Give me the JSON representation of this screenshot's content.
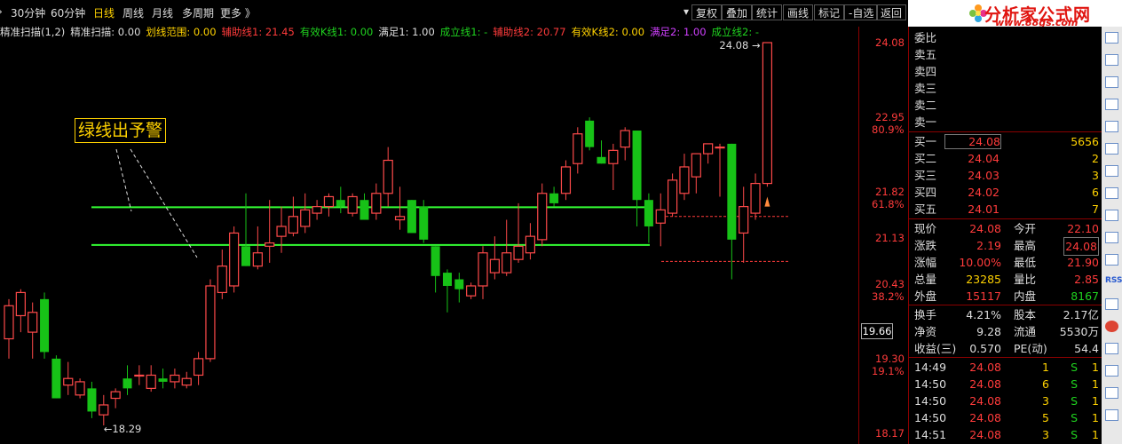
{
  "toolbar": {
    "periods": [
      "30分钟",
      "60分钟",
      "日线",
      "周线",
      "月线",
      "多周期",
      "更多 》"
    ],
    "active_period": "日线",
    "buttons": [
      "复权",
      "叠加",
      "统计",
      "画线",
      "标记",
      "-自选",
      "返回"
    ]
  },
  "indicator_bar": [
    {
      "label": "精准扫描(1,2)",
      "color": "#dddddd"
    },
    {
      "label": "精准扫描: 0.00",
      "color": "#dddddd"
    },
    {
      "label": "划线范围: 0.00",
      "color": "#ffd200"
    },
    {
      "label": "辅助线1: 21.45",
      "color": "#ff3b3b"
    },
    {
      "label": "有效K线1: 0.00",
      "color": "#1fd21f"
    },
    {
      "label": "满足1: 1.00",
      "color": "#dddddd"
    },
    {
      "label": "成立线1: -",
      "color": "#1fd21f"
    },
    {
      "label": "辅助线2: 20.77",
      "color": "#ff3b3b"
    },
    {
      "label": "有效K线2: 0.00",
      "color": "#ffd200"
    },
    {
      "label": "满足2: 1.00",
      "color": "#d040ff"
    },
    {
      "label": "成立线2: -",
      "color": "#1fd21f"
    }
  ],
  "annotation": "绿线出予警",
  "price_axis": [
    {
      "price": "24.08",
      "pct": ""
    },
    {
      "price": "22.95",
      "pct": "80.9%"
    },
    {
      "price": "21.82",
      "pct": "61.8%"
    },
    {
      "price": "21.13",
      "pct": ""
    },
    {
      "price": "20.43",
      "pct": "38.2%"
    },
    {
      "price": "19.30",
      "pct": "19.1%"
    },
    {
      "price": "18.17",
      "pct": ""
    }
  ],
  "current_price_tag": "19.66",
  "high_marker": "24.08",
  "low_marker": "18.29",
  "chart_data": {
    "type": "candlestick",
    "ylim": [
      18.0,
      24.5
    ],
    "candles": [
      {
        "o": 19.6,
        "h": 20.2,
        "l": 19.3,
        "c": 20.1
      },
      {
        "o": 19.95,
        "h": 20.35,
        "l": 19.7,
        "c": 20.3
      },
      {
        "o": 19.7,
        "h": 20.15,
        "l": 19.3,
        "c": 20.0
      },
      {
        "o": 20.2,
        "h": 20.3,
        "l": 19.3,
        "c": 19.4
      },
      {
        "o": 19.3,
        "h": 19.35,
        "l": 18.7,
        "c": 18.7
      },
      {
        "o": 18.9,
        "h": 19.25,
        "l": 18.75,
        "c": 19.0
      },
      {
        "o": 18.75,
        "h": 19.0,
        "l": 18.7,
        "c": 18.95
      },
      {
        "o": 18.85,
        "h": 18.95,
        "l": 18.4,
        "c": 18.5
      },
      {
        "o": 18.45,
        "h": 18.75,
        "l": 18.29,
        "c": 18.6
      },
      {
        "o": 18.7,
        "h": 18.85,
        "l": 18.55,
        "c": 18.8
      },
      {
        "o": 19.0,
        "h": 19.2,
        "l": 18.75,
        "c": 18.85
      },
      {
        "o": 19.05,
        "h": 19.2,
        "l": 18.9,
        "c": 19.05
      },
      {
        "o": 18.85,
        "h": 19.2,
        "l": 18.8,
        "c": 19.05
      },
      {
        "o": 19.0,
        "h": 19.15,
        "l": 18.85,
        "c": 18.95
      },
      {
        "o": 18.95,
        "h": 19.15,
        "l": 18.85,
        "c": 19.05
      },
      {
        "o": 18.9,
        "h": 19.1,
        "l": 18.85,
        "c": 19.0
      },
      {
        "o": 19.05,
        "h": 19.4,
        "l": 18.9,
        "c": 19.3
      },
      {
        "o": 19.3,
        "h": 20.5,
        "l": 19.25,
        "c": 20.4
      },
      {
        "o": 20.3,
        "h": 20.95,
        "l": 20.2,
        "c": 20.7
      },
      {
        "o": 20.4,
        "h": 21.3,
        "l": 20.3,
        "c": 21.2
      },
      {
        "o": 21.0,
        "h": 21.8,
        "l": 20.7,
        "c": 20.7
      },
      {
        "o": 20.7,
        "h": 21.3,
        "l": 20.65,
        "c": 20.9
      },
      {
        "o": 21.0,
        "h": 21.7,
        "l": 20.75,
        "c": 21.05
      },
      {
        "o": 21.15,
        "h": 21.6,
        "l": 20.9,
        "c": 21.3
      },
      {
        "o": 21.2,
        "h": 21.75,
        "l": 21.15,
        "c": 21.45
      },
      {
        "o": 21.3,
        "h": 21.8,
        "l": 21.2,
        "c": 21.55
      },
      {
        "o": 21.5,
        "h": 21.7,
        "l": 21.4,
        "c": 21.6
      },
      {
        "o": 21.6,
        "h": 21.8,
        "l": 21.45,
        "c": 21.75
      },
      {
        "o": 21.7,
        "h": 21.9,
        "l": 21.5,
        "c": 21.6
      },
      {
        "o": 21.5,
        "h": 21.8,
        "l": 21.45,
        "c": 21.75
      },
      {
        "o": 21.7,
        "h": 21.8,
        "l": 21.4,
        "c": 21.4
      },
      {
        "o": 21.5,
        "h": 21.95,
        "l": 21.4,
        "c": 21.8
      },
      {
        "o": 21.8,
        "h": 22.5,
        "l": 21.6,
        "c": 22.3
      },
      {
        "o": 21.4,
        "h": 21.9,
        "l": 21.25,
        "c": 21.45
      },
      {
        "o": 21.7,
        "h": 21.7,
        "l": 21.35,
        "c": 21.2
      },
      {
        "o": 21.6,
        "h": 21.7,
        "l": 21.05,
        "c": 21.1
      },
      {
        "o": 21.0,
        "h": 21.0,
        "l": 20.3,
        "c": 20.55
      },
      {
        "o": 20.6,
        "h": 20.65,
        "l": 20.0,
        "c": 20.4
      },
      {
        "o": 20.5,
        "h": 20.6,
        "l": 20.15,
        "c": 20.35
      },
      {
        "o": 20.25,
        "h": 20.45,
        "l": 20.2,
        "c": 20.4
      },
      {
        "o": 20.4,
        "h": 21.0,
        "l": 20.2,
        "c": 20.9
      },
      {
        "o": 20.6,
        "h": 21.15,
        "l": 20.5,
        "c": 20.8
      },
      {
        "o": 20.6,
        "h": 21.4,
        "l": 20.55,
        "c": 20.9
      },
      {
        "o": 20.8,
        "h": 21.65,
        "l": 20.75,
        "c": 21.0
      },
      {
        "o": 20.9,
        "h": 21.35,
        "l": 20.8,
        "c": 21.15
      },
      {
        "o": 21.1,
        "h": 21.95,
        "l": 21.0,
        "c": 21.8
      },
      {
        "o": 21.8,
        "h": 21.9,
        "l": 21.6,
        "c": 21.65
      },
      {
        "o": 21.8,
        "h": 22.3,
        "l": 21.7,
        "c": 22.2
      },
      {
        "o": 22.25,
        "h": 22.8,
        "l": 22.1,
        "c": 22.7
      },
      {
        "o": 22.9,
        "h": 22.95,
        "l": 22.45,
        "c": 22.5
      },
      {
        "o": 22.35,
        "h": 22.6,
        "l": 22.25,
        "c": 22.25
      },
      {
        "o": 22.25,
        "h": 22.55,
        "l": 21.85,
        "c": 22.45
      },
      {
        "o": 22.5,
        "h": 22.8,
        "l": 22.3,
        "c": 22.75
      },
      {
        "o": 22.75,
        "h": 22.75,
        "l": 21.3,
        "c": 21.7
      },
      {
        "o": 21.7,
        "h": 21.8,
        "l": 21.05,
        "c": 21.3
      },
      {
        "o": 21.35,
        "h": 21.8,
        "l": 21.0,
        "c": 21.55
      },
      {
        "o": 21.5,
        "h": 22.1,
        "l": 21.45,
        "c": 22.0
      },
      {
        "o": 21.8,
        "h": 22.4,
        "l": 21.7,
        "c": 22.2
      },
      {
        "o": 22.05,
        "h": 22.4,
        "l": 21.8,
        "c": 22.4
      },
      {
        "o": 22.4,
        "h": 22.55,
        "l": 22.25,
        "c": 22.55
      },
      {
        "o": 22.5,
        "h": 22.55,
        "l": 21.75,
        "c": 22.5
      },
      {
        "o": 22.55,
        "h": 22.55,
        "l": 20.5,
        "c": 21.1
      },
      {
        "o": 21.2,
        "h": 21.9,
        "l": 20.75,
        "c": 21.6
      },
      {
        "o": 21.5,
        "h": 22.1,
        "l": 21.4,
        "c": 21.95
      },
      {
        "o": 21.95,
        "h": 24.08,
        "l": 21.9,
        "c": 24.08
      }
    ],
    "horizontal_lines": [
      21.59,
      21.02
    ],
    "dashed_lines": [
      21.45,
      20.77
    ]
  },
  "quote_panel": {
    "ask_label": "委比",
    "ask_rows": [
      {
        "label": "卖五",
        "price": "",
        "vol": ""
      },
      {
        "label": "卖四",
        "price": "",
        "vol": ""
      },
      {
        "label": "卖三",
        "price": "",
        "vol": ""
      },
      {
        "label": "卖二",
        "price": "",
        "vol": ""
      },
      {
        "label": "卖一",
        "price": "",
        "vol": ""
      }
    ],
    "bid_rows": [
      {
        "label": "买一",
        "price": "24.08",
        "vol": "5656"
      },
      {
        "label": "买二",
        "price": "24.04",
        "vol": "2"
      },
      {
        "label": "买三",
        "price": "24.03",
        "vol": "3"
      },
      {
        "label": "买四",
        "price": "24.02",
        "vol": "6"
      },
      {
        "label": "买五",
        "price": "24.01",
        "vol": "7"
      }
    ],
    "stats": [
      {
        "l1": "现价",
        "v1": "24.08",
        "c1": "red",
        "l2": "今开",
        "v2": "22.10",
        "c2": "red"
      },
      {
        "l1": "涨跌",
        "v1": "2.19",
        "c1": "red",
        "l2": "最高",
        "v2": "24.08",
        "c2": "red"
      },
      {
        "l1": "涨幅",
        "v1": "10.00%",
        "c1": "red",
        "l2": "最低",
        "v2": "21.90",
        "c2": "red"
      },
      {
        "l1": "总量",
        "v1": "23285",
        "c1": "yel",
        "l2": "量比",
        "v2": "2.85",
        "c2": "red"
      },
      {
        "l1": "外盘",
        "v1": "15117",
        "c1": "red",
        "l2": "内盘",
        "v2": "8167",
        "c2": "grn"
      }
    ],
    "stats2": [
      {
        "l1": "换手",
        "v1": "4.21%",
        "l2": "股本",
        "v2": "2.17亿"
      },
      {
        "l1": "净资",
        "v1": "9.28",
        "l2": "流通",
        "v2": "5530万"
      },
      {
        "l1": "收益(三)",
        "v1": "0.570",
        "l2": "PE(动)",
        "v2": "54.4"
      }
    ],
    "ticks": [
      {
        "time": "14:49",
        "price": "24.08",
        "vol": "1",
        "side": "S",
        "num": "1"
      },
      {
        "time": "14:50",
        "price": "24.08",
        "vol": "6",
        "side": "S",
        "num": "1"
      },
      {
        "time": "14:50",
        "price": "24.08",
        "vol": "3",
        "side": "S",
        "num": "1"
      },
      {
        "time": "14:50",
        "price": "24.08",
        "vol": "5",
        "side": "S",
        "num": "1"
      },
      {
        "time": "14:51",
        "price": "24.08",
        "vol": "3",
        "side": "S",
        "num": "1"
      }
    ]
  },
  "logo": {
    "title": "分析家公式网",
    "url": "www.88gs.com"
  }
}
